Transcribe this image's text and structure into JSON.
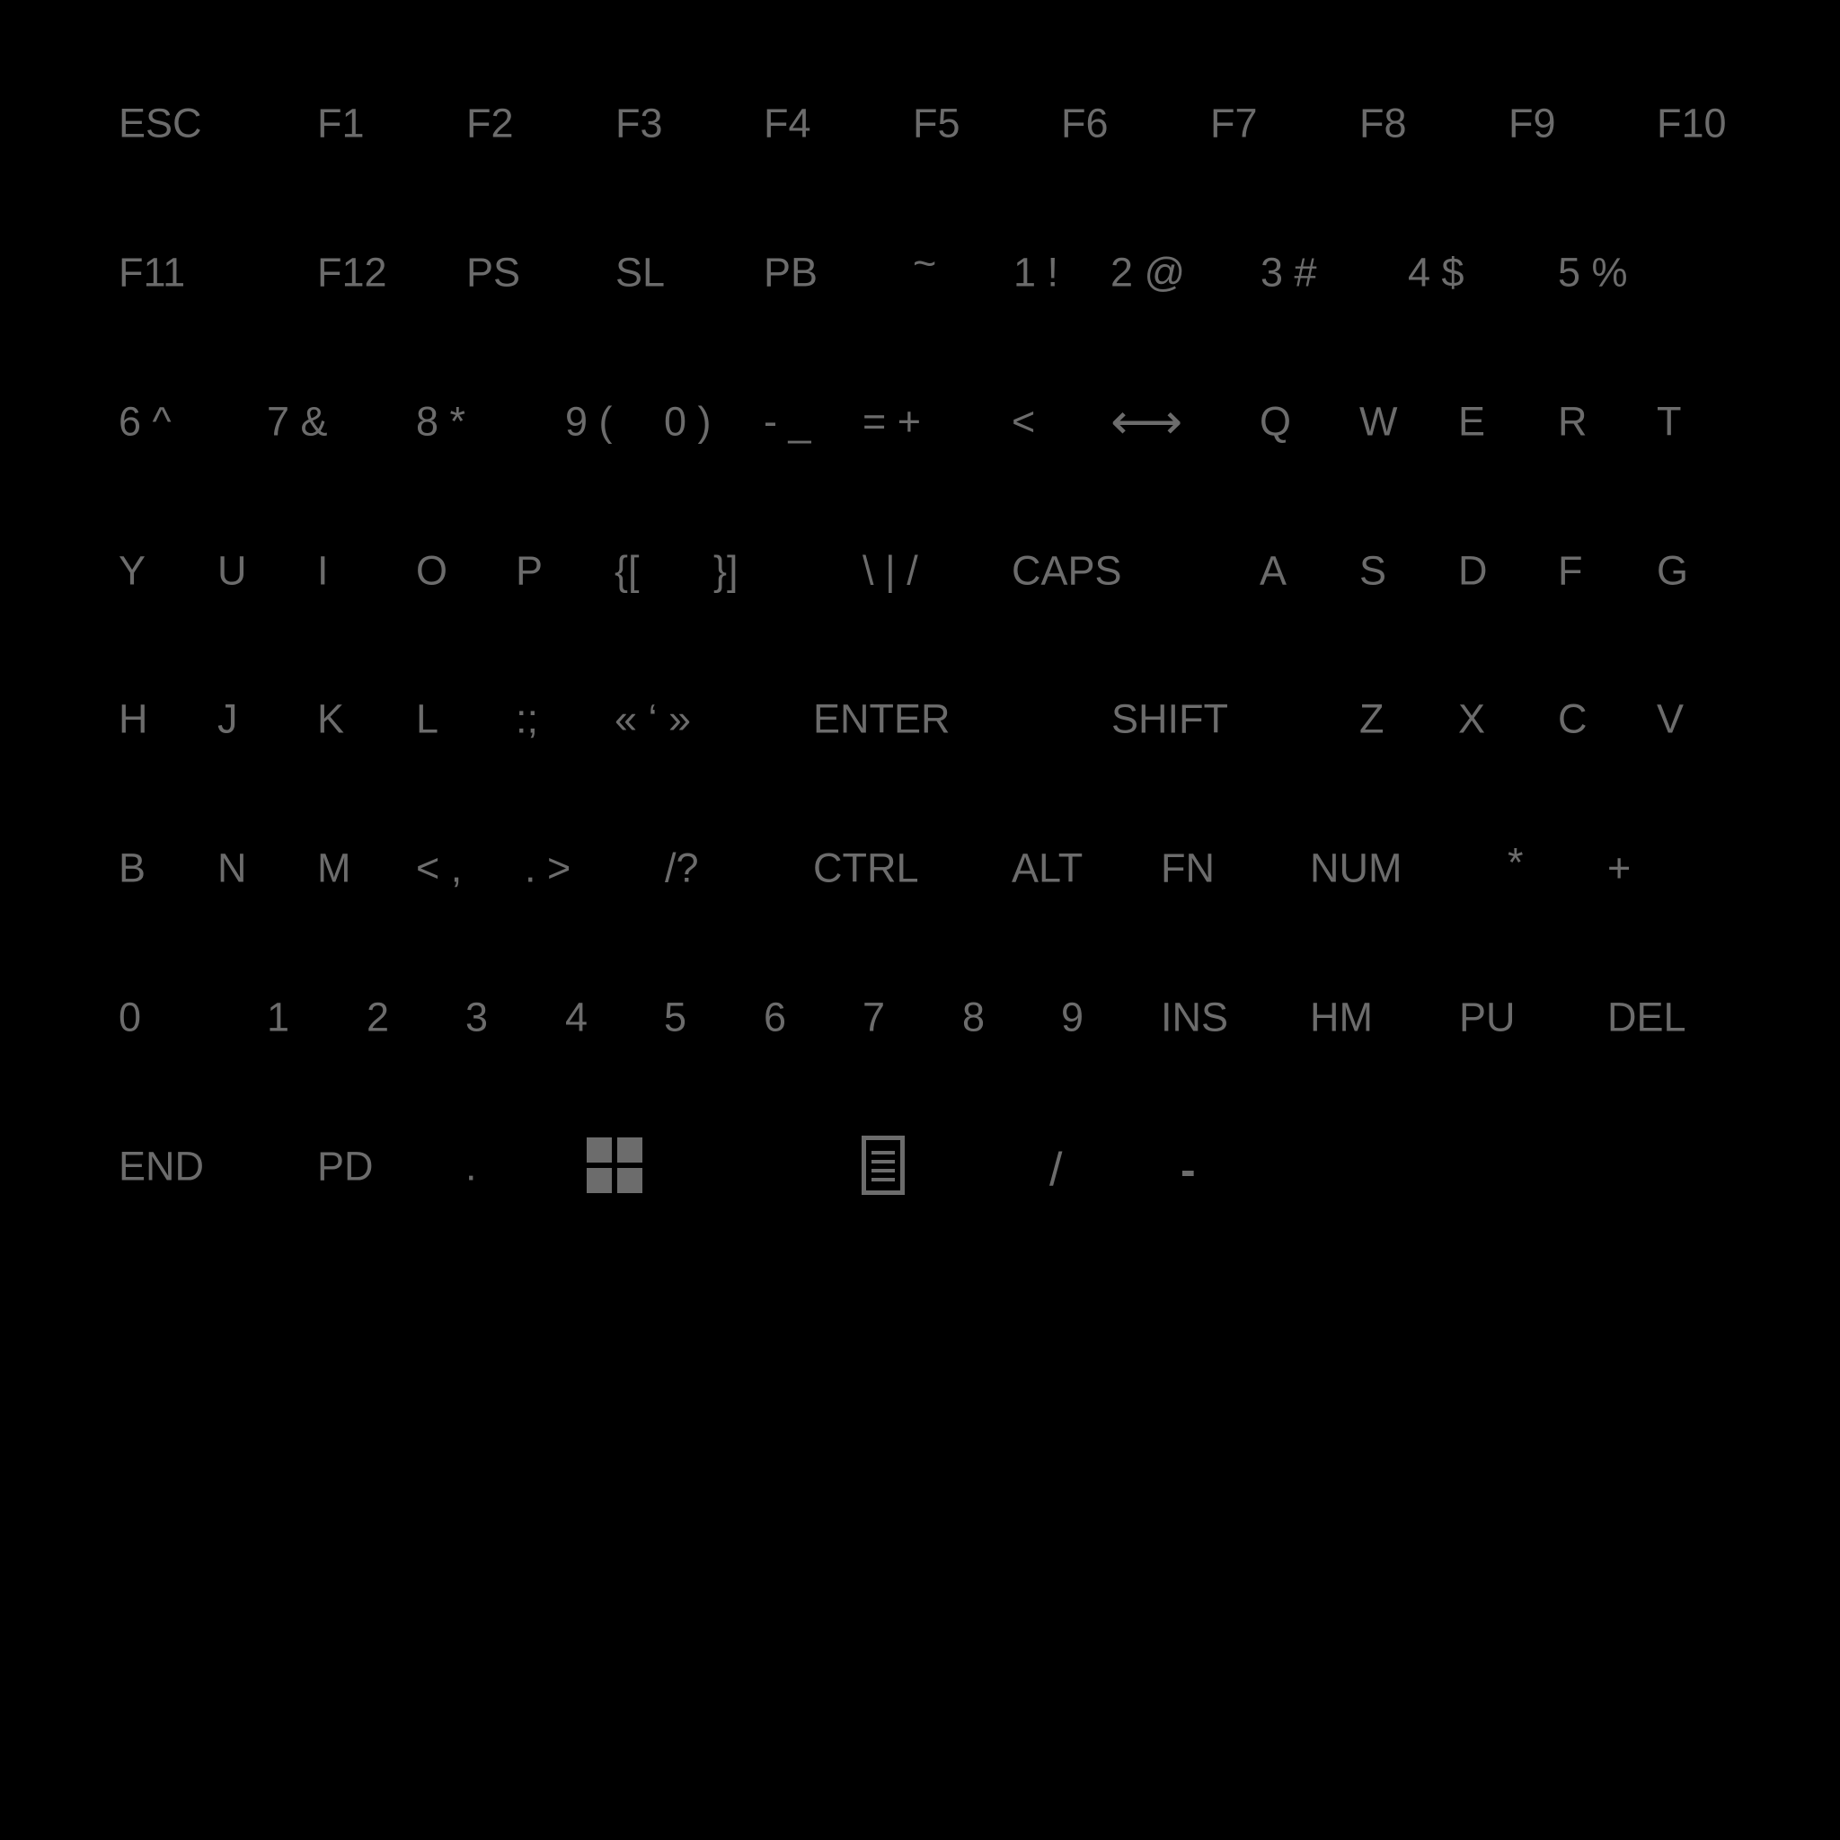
{
  "theme": {
    "background": "#000000",
    "key_color": "#6c6c6c"
  },
  "rows": {
    "r0": [
      "ESC",
      "F1",
      "F2",
      "F3",
      "F4",
      "F5",
      "F6",
      "F7",
      "F8",
      "F9",
      "F10"
    ],
    "r1": [
      "F11",
      "F12",
      "PS",
      "SL",
      "PB",
      "~",
      "1 !",
      "2 @",
      "3 #",
      "4 $",
      "5 %"
    ],
    "r2": [
      "6 ^",
      "7 &",
      "8 *",
      "9 (",
      "0 )",
      "- _",
      "= +",
      "<",
      "⟷",
      "Q",
      "W",
      "E",
      "R",
      "T"
    ],
    "r3": [
      "Y",
      "U",
      "I",
      "O",
      "P",
      "{[",
      "}]",
      "\\ | /",
      "CAPS",
      "A",
      "S",
      "D",
      "F",
      "G"
    ],
    "r4": [
      "H",
      "J",
      "K",
      "L",
      ":;",
      "« ‘ »",
      "ENTER",
      "SHIFT",
      "Z",
      "X",
      "C",
      "V"
    ],
    "r5": [
      "B",
      "N",
      "M",
      "< ,",
      ". >",
      "/?",
      "CTRL",
      "ALT",
      "FN",
      "NUM",
      "*",
      "+"
    ],
    "r6": [
      "0",
      "1",
      "2",
      "3",
      "4",
      "5",
      "6",
      "7",
      "8",
      "9",
      "INS",
      "HM",
      "PU",
      "DEL"
    ],
    "r7": [
      "END",
      "PD",
      ".",
      "/",
      "-"
    ]
  },
  "icons": {
    "windows": "windows-icon",
    "menu": "menu-icon"
  }
}
